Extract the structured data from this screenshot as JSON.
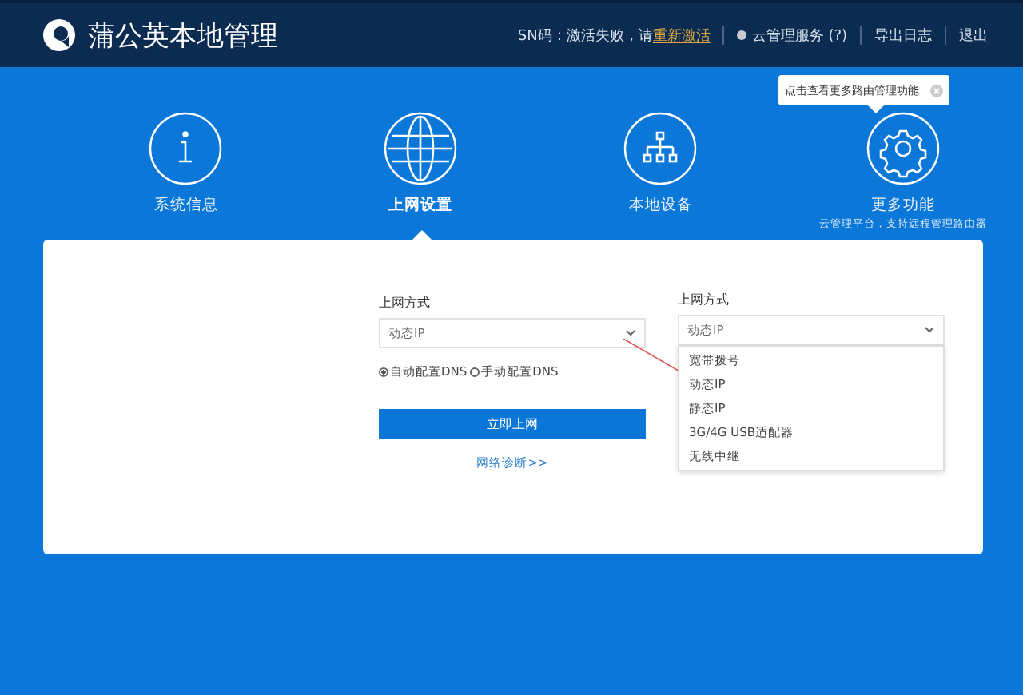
{
  "header": {
    "title": "蒲公英本地管理",
    "sn_text": "SN码：激活失败，请",
    "sn_link": "重新激活",
    "cloud_service": "云管理服务 (?)",
    "export_log": "导出日志",
    "logout": "退出"
  },
  "tooltip": {
    "text": "点击查看更多路由管理功能"
  },
  "nav": [
    {
      "kind": "info",
      "label": "系统信息",
      "selected": false
    },
    {
      "kind": "globe",
      "label": "上网设置",
      "selected": true
    },
    {
      "kind": "network",
      "label": "本地设备",
      "selected": false
    },
    {
      "kind": "gear",
      "label": "更多功能",
      "subtitle": "云管理平台，支持远程管理路由器",
      "selected": false
    }
  ],
  "form_left": {
    "label": "上网方式",
    "value": "动态IP",
    "dns_options": [
      {
        "label": "自动配置DNS",
        "selected": true
      },
      {
        "label": "手动配置DNS",
        "selected": false
      }
    ],
    "submit": "立即上网",
    "diagnose": "网络诊断>>"
  },
  "form_right": {
    "label": "上网方式",
    "value": "动态IP",
    "options": [
      "宽带拨号",
      "动态IP",
      "静态IP",
      "3G/4G USB适配器",
      "无线中继"
    ]
  }
}
